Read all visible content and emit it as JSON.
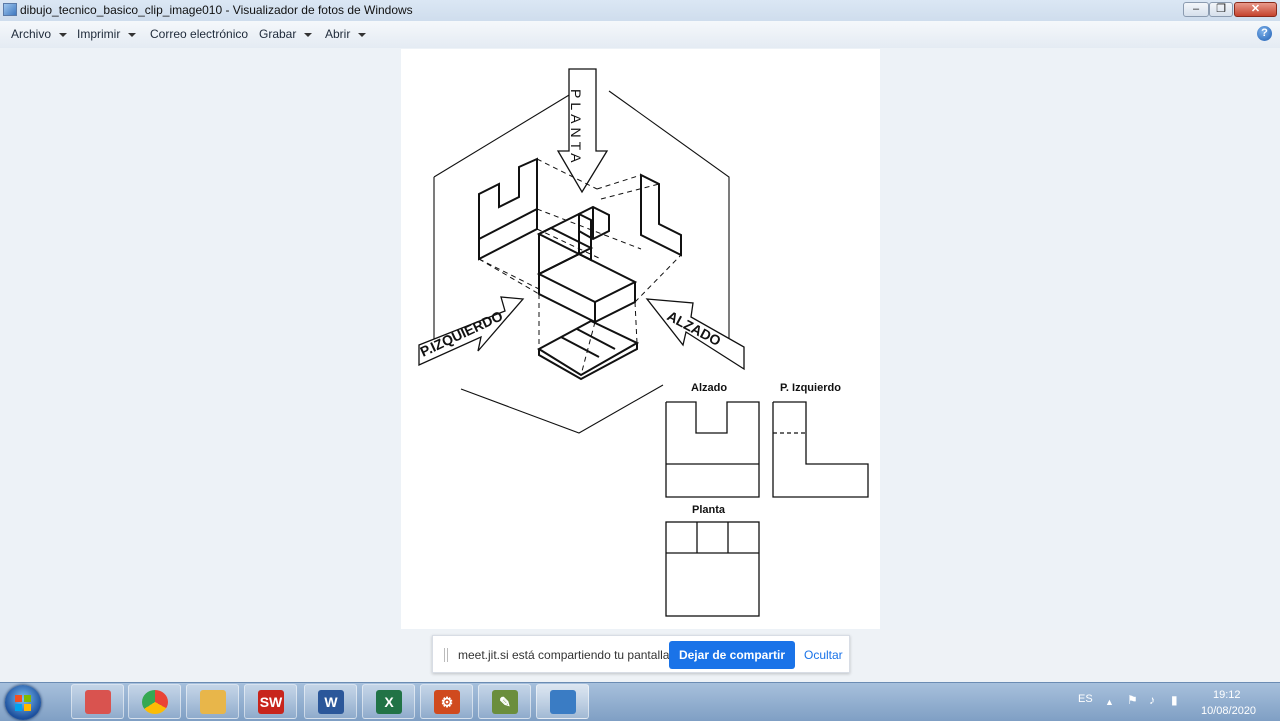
{
  "window": {
    "title": "dibujo_tecnico_basico_clip_image010 - Visualizador de fotos de Windows",
    "minimize_glyph": "‒",
    "maximize_glyph": "❐",
    "close_glyph": "✕"
  },
  "menu": {
    "items": [
      {
        "label": "Archivo",
        "has_arrow": true
      },
      {
        "label": "Imprimir",
        "has_arrow": true
      },
      {
        "label": "Correo electrónico",
        "has_arrow": false
      },
      {
        "label": "Grabar",
        "has_arrow": true
      },
      {
        "label": "Abrir",
        "has_arrow": true
      }
    ],
    "help_glyph": "?"
  },
  "drawing": {
    "arrow_top": "PLANTA",
    "arrow_left": "P.IZQUIERDO",
    "arrow_right": "ALZADO",
    "view_alzado": "Alzado",
    "view_izquierdo": "P. Izquierdo",
    "view_planta": "Planta"
  },
  "share_bar": {
    "message": "meet.jit.si está compartiendo tu pantalla.",
    "stop_button": "Dejar de compartir",
    "hide_link": "Ocultar"
  },
  "taskbar": {
    "apps": [
      {
        "name": "paint",
        "icon": "paint-icon",
        "color": "#d9534f"
      },
      {
        "name": "chrome",
        "icon": "chrome-icon",
        "color": "#34a853"
      },
      {
        "name": "explorer",
        "icon": "folder-icon",
        "color": "#e8b64a"
      },
      {
        "name": "solidworks",
        "icon": "solidworks-icon",
        "color": "#c8251c",
        "label": "SW"
      },
      {
        "name": "word",
        "icon": "word-icon",
        "color": "#2b579a",
        "label": "W"
      },
      {
        "name": "excel",
        "icon": "excel-icon",
        "color": "#217346",
        "label": "X"
      },
      {
        "name": "settings",
        "icon": "gear-icon",
        "color": "#d04a1e"
      },
      {
        "name": "pen",
        "icon": "pen-icon",
        "color": "#6b8e3c"
      },
      {
        "name": "photo-viewer",
        "icon": "photo-viewer-icon",
        "color": "#3a7cc4"
      }
    ],
    "tray": {
      "language": "ES",
      "time": "19:12",
      "date": "10/08/2020"
    }
  },
  "colors": {
    "accent": "#1a73e8",
    "taskbar": "#8ba9cc"
  }
}
